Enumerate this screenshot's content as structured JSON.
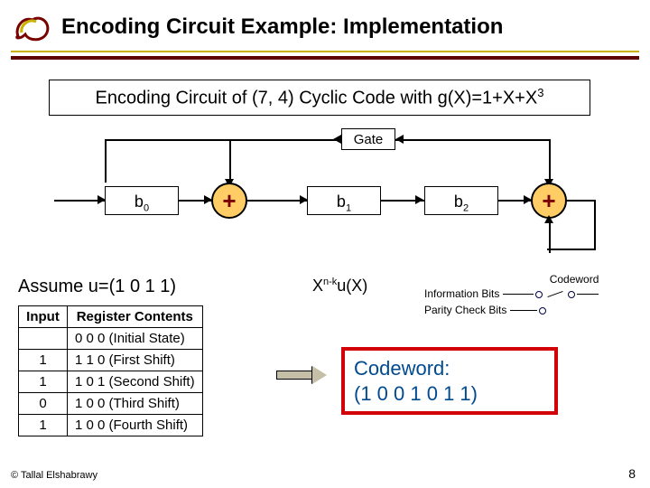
{
  "title": "Encoding Circuit Example: Implementation",
  "subtitle": {
    "before": "Encoding Circuit of (7, 4) Cyclic Code with g(X)=1+X+X",
    "sup": "3"
  },
  "gate_label": "Gate",
  "registers": {
    "b0": "b",
    "b0_sub": "0",
    "b1": "b",
    "b1_sub": "1",
    "b2": "b",
    "b2_sub": "2"
  },
  "adder_symbol": "+",
  "assume_text": "Assume u=(1 0 1 1)",
  "expr": {
    "x": "X",
    "sup": "n-k",
    "rest": "u(X)"
  },
  "out_labels": {
    "codeword": "Codeword",
    "info": "Information Bits",
    "parity": "Parity Check Bits"
  },
  "table": {
    "headers": [
      "Input",
      "Register Contents"
    ],
    "rows": [
      {
        "in": "",
        "reg": "0 0 0 (Initial State)"
      },
      {
        "in": "1",
        "reg": "1 1 0 (First Shift)"
      },
      {
        "in": "1",
        "reg": "1 0 1 (Second Shift)"
      },
      {
        "in": "0",
        "reg": "1 0 0 (Third Shift)"
      },
      {
        "in": "1",
        "reg": "1 0 0 (Fourth Shift)"
      }
    ]
  },
  "codeword_box": {
    "line1": "Codeword:",
    "line2": " (1 0 0 1 0 1 1)"
  },
  "footer_left": "© Tallal Elshabrawy",
  "footer_right": "8"
}
